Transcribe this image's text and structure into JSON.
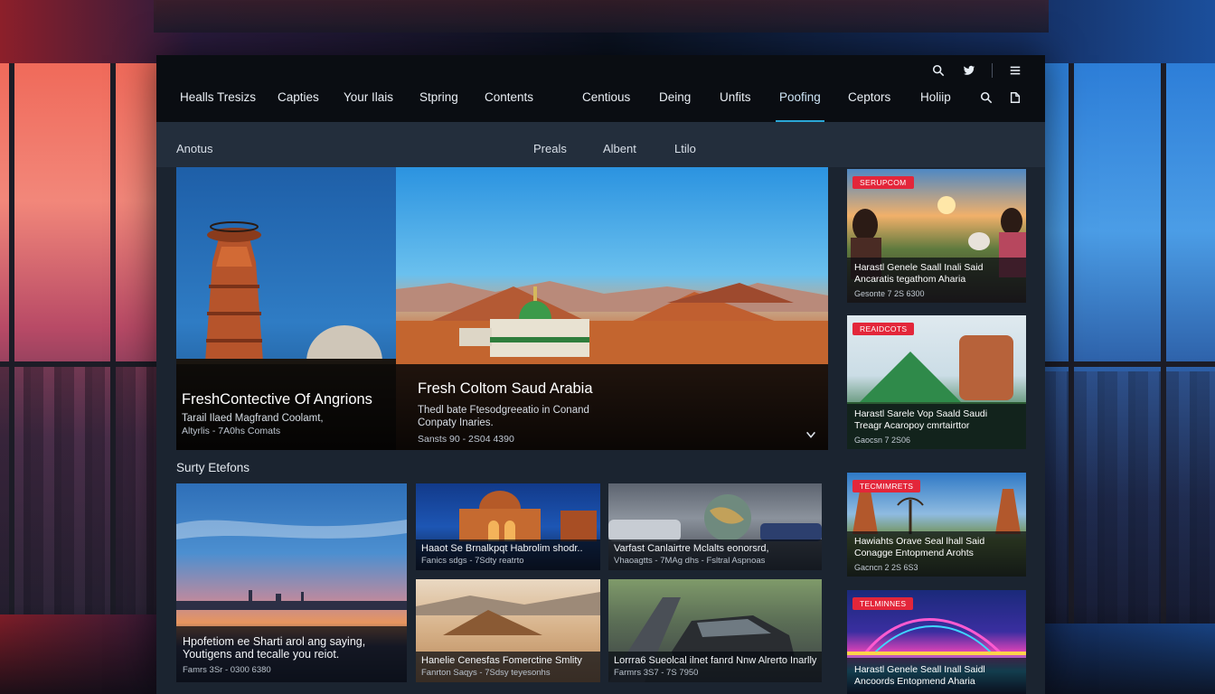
{
  "nav": {
    "items": [
      "Healls Tresizs",
      "Capties",
      "Your Ilais",
      "Stpring",
      "Contents",
      "Centious",
      "Deing",
      "Unfits",
      "Poofing",
      "Ceptors",
      "Holiip"
    ],
    "active_index": 8
  },
  "subnav": {
    "left": "Anotus",
    "items": [
      "Preals",
      "Albent",
      "Ltilo"
    ]
  },
  "hero": {
    "left": {
      "title": "FreshContective Of Angrions",
      "desc": "Tarail Ilaed Magfrand Coolamt,",
      "meta": "Altyrlis - 7A0hs Comats"
    },
    "main": {
      "title": "Fresh Coltom Saud Arabia",
      "desc_line1": "Thedl bate Ftesodgreeatio in Conand",
      "desc_line2": "Conpaty Inaries.",
      "meta": "Sansts 90 - 2S04 4390"
    }
  },
  "section": {
    "title": "Surty Etefons"
  },
  "cards": {
    "big": {
      "title_line1": "Hpofetiom ee Sharti arol ang saying,",
      "title_line2": "Youtigens and tecalle you reiot.",
      "meta": "Famrs 3Sr - 0300 6380"
    },
    "c1": {
      "title": "Haaot Se Brnalkpqt Habrolim shodr..",
      "meta": "Fanics sdgs - 7Sdty reatrto"
    },
    "c2": {
      "title": "Varfast Canlairtre Mclalts eonorsrd,",
      "meta": "Vhaoagtts - 7MAg dhs - Fsltral Aspnoas"
    },
    "c3": {
      "title": "Hanelie Cenesfas Fomerctine Smlity",
      "meta": "Fanrton Saqys - 7Sdsy teyesonhs"
    },
    "c4": {
      "title": "Lorrra6 Sueolcal ilnet fanrd Nnw Alrerto Inarlly",
      "meta": "Farmrs 3S7 - 7S 7950"
    }
  },
  "side": [
    {
      "badge": "SERUPCOM",
      "title_line1": "Harastl Genele Saall Inali Said",
      "title_line2": "Ancaratis tegathom Aharia",
      "meta": "Gesonte 7 2S 6300"
    },
    {
      "badge": "REAIDCOTS",
      "title_line1": "Harastl Sarele Vop Saald Saudi",
      "title_line2": "Treagr Acaropoy cmrtairttor",
      "meta": "Gaocsn 7 2S06"
    },
    {
      "badge": "TECMIMRETS",
      "title_line1": "Hawiahts Orave Seal lhall Said",
      "title_line2": "Conagge Entopmend Arohts",
      "meta": "Gacncn 2 2S 6S3"
    },
    {
      "badge": "TELMINNES",
      "title_line1": "Harastl Genele Seall Inall Saidl",
      "title_line2": "Ancoords Entopmend Aharia",
      "meta": ""
    }
  ],
  "colors": {
    "accent": "#2aa6d6",
    "badge": "#e3263a",
    "topbar": "#0a0d12",
    "panel": "#1b2430"
  },
  "icons": [
    "search-icon",
    "twitter-icon",
    "menu-icon",
    "search-icon",
    "share-icon",
    "chevron-down-icon"
  ]
}
